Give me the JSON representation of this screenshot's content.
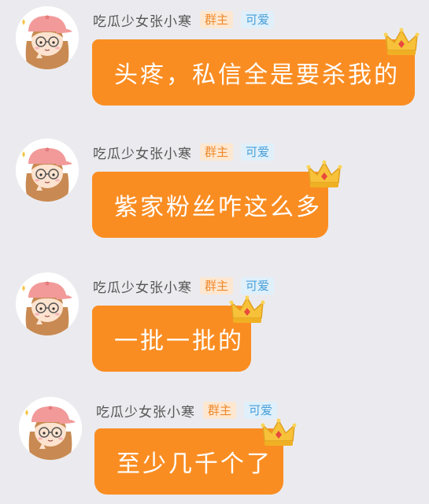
{
  "messages": [
    {
      "sender": "吃瓜少女张小寒",
      "badges": [
        "群主",
        "可爱"
      ],
      "text": "头疼，私信全是要杀我的",
      "avatar_icon": "girl-avatar-icon",
      "crown_icon": "crown-icon"
    },
    {
      "sender": "吃瓜少女张小寒",
      "badges": [
        "群主",
        "可爱"
      ],
      "text": "紫家粉丝咋这么多",
      "avatar_icon": "girl-avatar-icon",
      "crown_icon": "crown-icon"
    },
    {
      "sender": "吃瓜少女张小寒",
      "badges": [
        "群主",
        "可爱"
      ],
      "text": "一批一批的",
      "avatar_icon": "girl-avatar-icon",
      "crown_icon": "crown-icon"
    },
    {
      "sender": "吃瓜少女张小寒",
      "badges": [
        "群主",
        "可爱"
      ],
      "text": "至少几千个了",
      "avatar_icon": "girl-avatar-icon",
      "crown_icon": "crown-icon"
    }
  ],
  "colors": {
    "background": "#ebebef",
    "bubble": "#fa8d22",
    "owner_badge_bg": "#fde7d0",
    "owner_badge_text": "#f0892c",
    "cute_badge_bg": "#dff0fb",
    "cute_badge_text": "#4a9fd8"
  }
}
